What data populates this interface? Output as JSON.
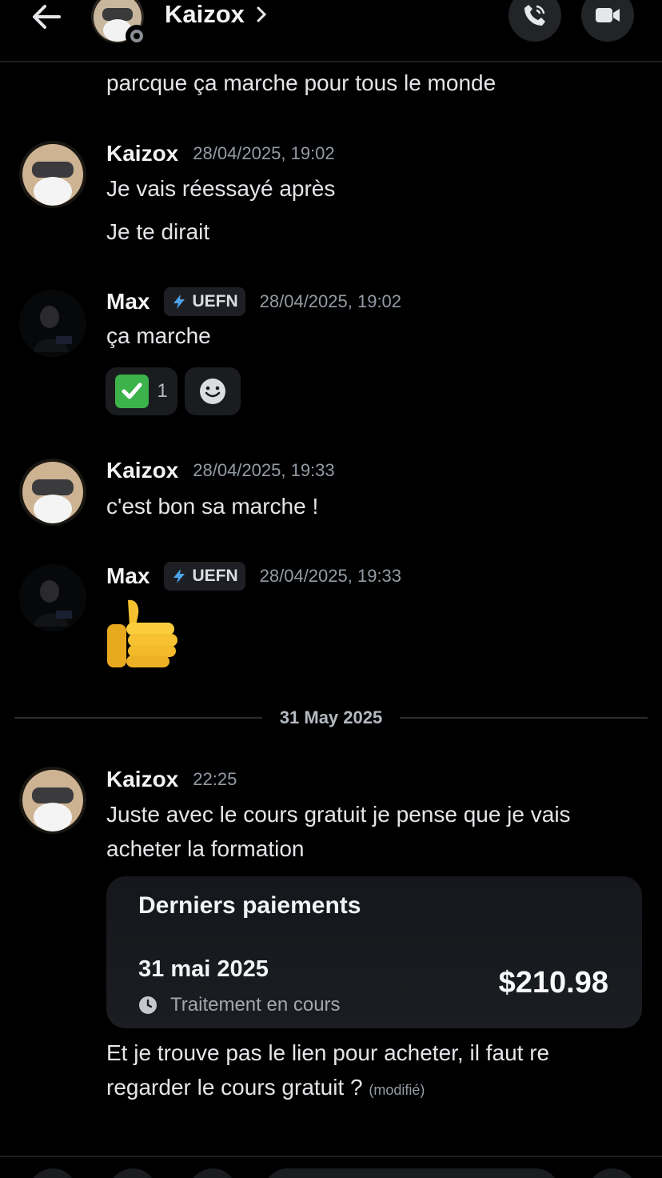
{
  "header": {
    "contact_name": "Kaizox",
    "icons": {
      "back": "arrow-left-icon",
      "chevron": "chevron-right-icon",
      "call": "phone-icon",
      "video": "video-camera-icon"
    }
  },
  "messages": [
    {
      "text": "parcque ça marche pour tous le monde"
    },
    {
      "author": "Kaizox",
      "timestamp": "28/04/2025, 19:02",
      "lines": [
        "Je vais réessayé après",
        "Je te dirait"
      ]
    },
    {
      "author": "Max",
      "badge": "UEFN",
      "timestamp": "28/04/2025, 19:02",
      "lines": [
        "ça marche"
      ],
      "reactions": [
        {
          "emoji": "white-check-mark",
          "count": "1"
        },
        {
          "emoji": "add-reaction-icon"
        }
      ]
    },
    {
      "author": "Kaizox",
      "timestamp": "28/04/2025, 19:33",
      "lines": [
        "c'est bon sa marche !"
      ]
    },
    {
      "author": "Max",
      "badge": "UEFN",
      "timestamp": "28/04/2025, 19:33",
      "emoji": "thumbs-up"
    },
    {
      "author": "Kaizox",
      "timestamp": "22:25",
      "lines": [
        "Juste avec le cours gratuit je pense que je vais",
        "acheter la formation"
      ],
      "lines_after": [
        "Et je trouve pas le lien pour acheter, il faut re",
        "regarder le cours gratuit ?"
      ],
      "edited": "(modifié)"
    }
  ],
  "date_divider": "31 May 2025",
  "payment_card": {
    "title": "Derniers paiements",
    "date": "31 mai 2025",
    "status": "Traitement en cours",
    "amount": "$210.98",
    "status_icon": "clock-icon"
  },
  "colors": {
    "background": "#000000",
    "text": "#e3e5e8",
    "muted": "#949ba4",
    "check_green": "#3cb34a",
    "badge_bg": "#1e1f24"
  }
}
